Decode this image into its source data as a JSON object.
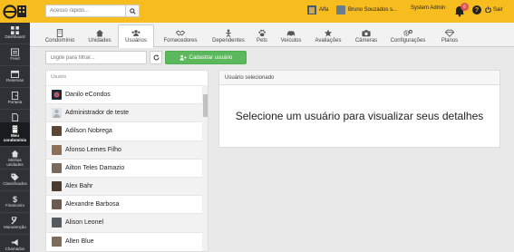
{
  "topbar": {
    "search_placeholder": "Acesso rápido...",
    "condo_name": "Alfa",
    "user_name": "Bruno Souzados s...",
    "role": "System Admin",
    "notifications_count": "6",
    "logout_label": "Sair"
  },
  "sidebar": {
    "items": [
      {
        "label": "Dashboard",
        "icon": "dashboard-icon"
      },
      {
        "label": "Feed",
        "icon": "feed-icon"
      },
      {
        "label": "Reservas",
        "icon": "calendar-icon"
      },
      {
        "label": "Portaria",
        "icon": "portaria-icon"
      },
      {
        "label": "Documentos",
        "icon": "documents-icon"
      },
      {
        "label": "Meu condomínio",
        "icon": "building-icon"
      },
      {
        "label": "Minhas unidades",
        "icon": "home-icon"
      },
      {
        "label": "Classificados",
        "icon": "tag-icon"
      },
      {
        "label": "Financeiro",
        "icon": "dollar-icon"
      },
      {
        "label": "Manutenção",
        "icon": "wrench-icon"
      },
      {
        "label": "Chamados",
        "icon": "megaphone-icon"
      }
    ]
  },
  "tabs": [
    {
      "label": "Condomínio",
      "icon": "building-icon"
    },
    {
      "label": "Unidades",
      "icon": "home-icon"
    },
    {
      "label": "Usuários",
      "icon": "users-icon"
    },
    {
      "label": "Fornecedores",
      "icon": "handshake-icon"
    },
    {
      "label": "Dependentes",
      "icon": "dependents-icon"
    },
    {
      "label": "Pets",
      "icon": "paw-icon"
    },
    {
      "label": "Veículos",
      "icon": "car-icon"
    },
    {
      "label": "Avaliações",
      "icon": "star-icon"
    },
    {
      "label": "Câmeras",
      "icon": "camera-icon"
    },
    {
      "label": "Configurações",
      "icon": "gears-icon"
    },
    {
      "label": "Planos",
      "icon": "diamond-icon"
    }
  ],
  "toolbar": {
    "filter_placeholder": "Digite para filtrar...",
    "add_label": "Cadastrar usuário"
  },
  "user_list": {
    "header": "Usuário",
    "users": [
      "Danilo eCondos",
      "Administrador de teste",
      "Adilson Nobrega",
      "Afonso Lemes Filho",
      "Ailton Teles Damazio",
      "Alex Bahr",
      "Alexandre Barbosa",
      "Alison Leonel",
      "Allen Blue"
    ]
  },
  "detail": {
    "header": "Usuário selecionado",
    "message": "Selecione um usuário para visualizar seus detalhes"
  },
  "colors": {
    "brand_yellow": "#f7bd1f",
    "sidebar_dark": "#2f3136",
    "success_green": "#5cb85c",
    "badge_red": "#d9534f"
  }
}
